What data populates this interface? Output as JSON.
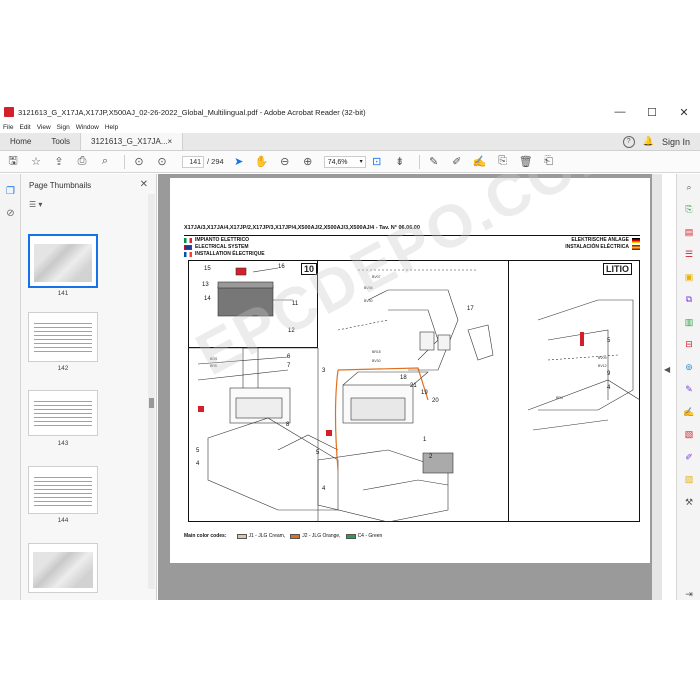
{
  "window": {
    "title": "3121613_G_X17JA,X17JP,X500AJ_02-26-2022_Global_Multilingual.pdf - Adobe Acrobat Reader (32-bit)",
    "controls": [
      "—",
      "☐",
      "✕"
    ]
  },
  "menu": [
    "File",
    "Edit",
    "View",
    "Sign",
    "Window",
    "Help"
  ],
  "tabs": {
    "home": "Home",
    "tools": "Tools",
    "document": "3121613_G_X17JA...",
    "document_close": "×",
    "help_icon": "?",
    "bell_icon": "🔔",
    "sign_in": "Sign In"
  },
  "toolbar": {
    "page_current": "141",
    "page_total": "/ 294",
    "zoom": "74,6%"
  },
  "thumbnails": {
    "title": "Page Thumbnails",
    "close": "✕",
    "options": "☰ ▾",
    "pages": [
      "141",
      "142",
      "143",
      "144"
    ]
  },
  "document": {
    "header": "X17JA/3,X17JA/4,X17JP/2,X17JP/3,X17JP/4,X500AJ/2,X500AJ/3,X500AJ/4 - Tav. N° 06.06.00",
    "lang_it": "IMPIANTO ELETTRICO",
    "lang_en": "ELECTRICAL SYSTEM",
    "lang_fr": "INSTALLATION ÉLECTRIQUE",
    "lang_de": "ELEKTRISCHE ANLAGE",
    "lang_es": "INSTALACIÓN ELÉCTRICA",
    "box_left_label": "10",
    "box_right_label": "LITIO",
    "callouts_left": [
      "15",
      "16",
      "13",
      "11",
      "14",
      "12",
      "6",
      "7",
      "8",
      "5",
      "4"
    ],
    "callouts_center": [
      "3",
      "1",
      "2",
      "5",
      "4"
    ],
    "callouts_center_top": [
      "17",
      "18",
      "21",
      "19",
      "20"
    ],
    "callouts_right": [
      "5",
      "9",
      "4"
    ],
    "wire_tags": [
      "BV07",
      "BV36",
      "BV30",
      "BR15",
      "BV30",
      "BOS",
      "BR5",
      "BR4",
      "BV09",
      "BV12"
    ],
    "legend_label": "Main color codes:",
    "legend": [
      {
        "code": "J1",
        "text": "J1 - JLG Cream,",
        "color": "#d9c7a0"
      },
      {
        "code": "J2",
        "text": "J2 - JLG Orange,",
        "color": "#e0701e"
      },
      {
        "code": "C4",
        "text": "C4 - Green",
        "color": "#2ea043"
      }
    ],
    "watermark": "EPCDEPO.COM"
  },
  "colors": {
    "accent": "#1473e6",
    "acrobat_red": "#d4202a",
    "doc_bg": "#9a9a9a"
  }
}
